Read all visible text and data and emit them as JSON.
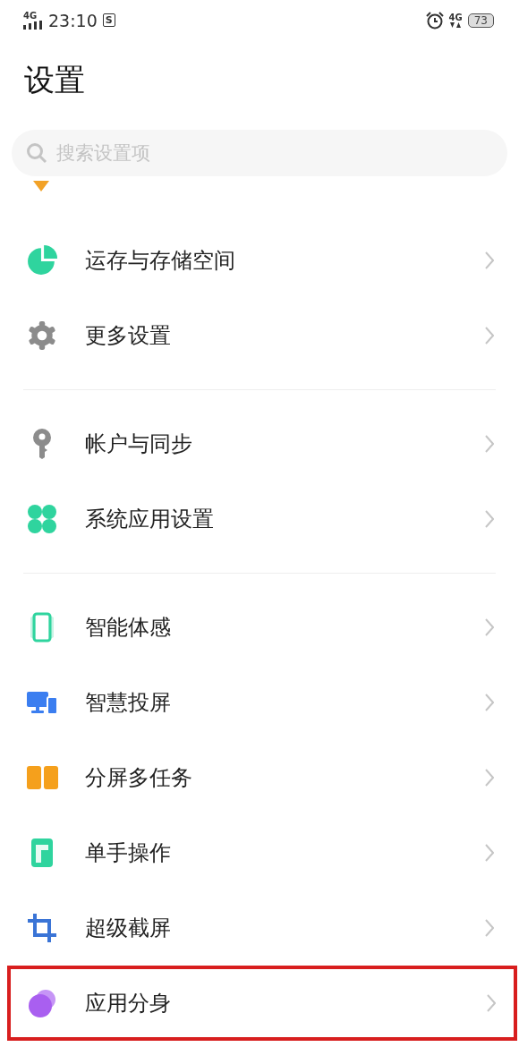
{
  "status_bar": {
    "signal_label": "4G",
    "time": "23:10",
    "notification": "S",
    "network": "4G",
    "battery": "73"
  },
  "title": "设置",
  "search": {
    "placeholder": "搜索设置项"
  },
  "groups": [
    {
      "items": [
        {
          "label": "运存与存储空间",
          "highlighted": false
        },
        {
          "label": "更多设置",
          "highlighted": false
        }
      ]
    },
    {
      "items": [
        {
          "label": "帐户与同步",
          "highlighted": false
        },
        {
          "label": "系统应用设置",
          "highlighted": false
        }
      ]
    },
    {
      "items": [
        {
          "label": "智能体感",
          "highlighted": false
        },
        {
          "label": "智慧投屏",
          "highlighted": false
        },
        {
          "label": "分屏多任务",
          "highlighted": false
        },
        {
          "label": "单手操作",
          "highlighted": false
        },
        {
          "label": "超级截屏",
          "highlighted": false
        },
        {
          "label": "应用分身",
          "highlighted": true
        }
      ]
    }
  ]
}
